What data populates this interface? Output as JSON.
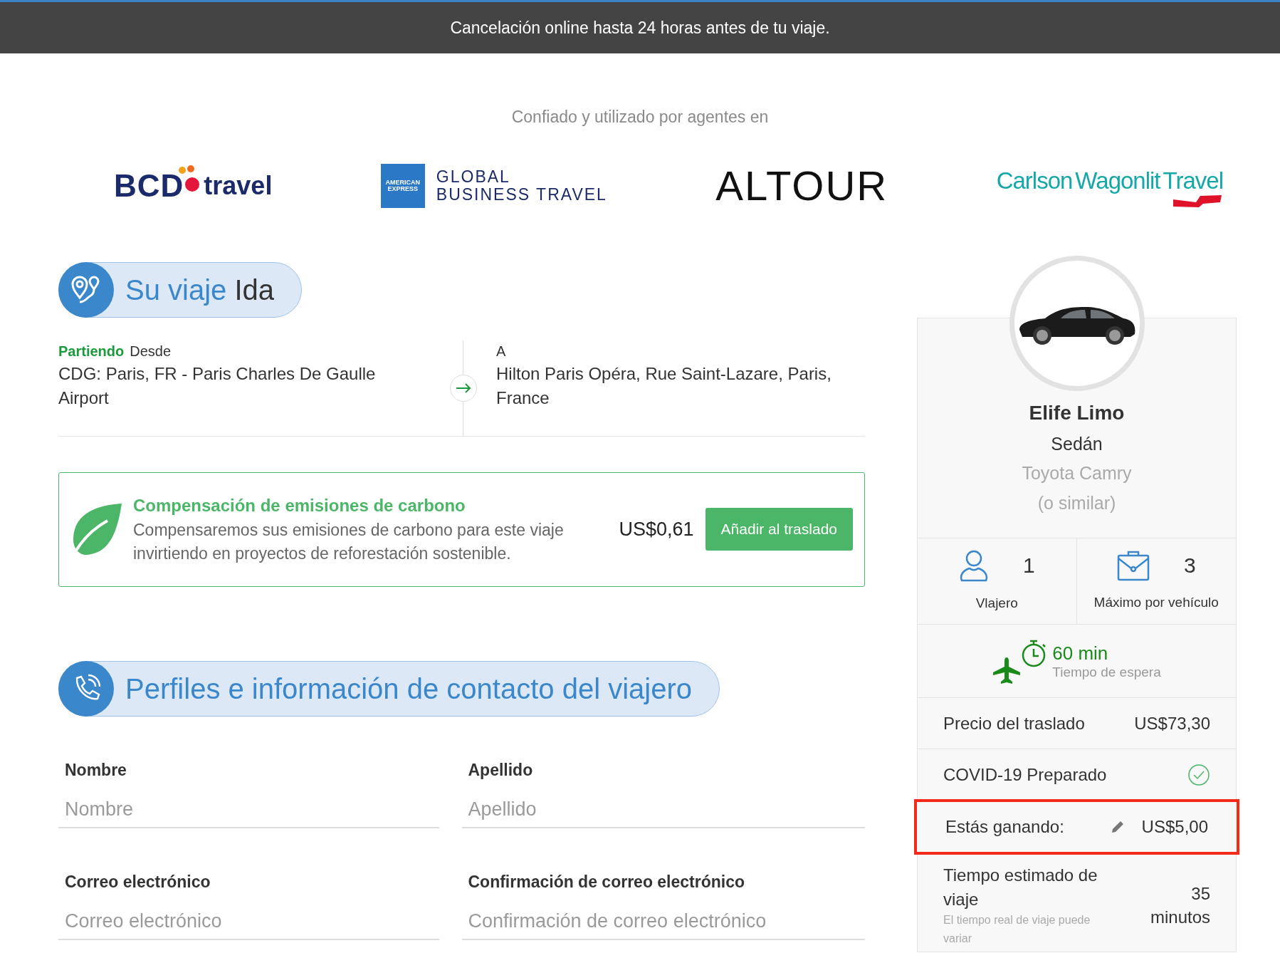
{
  "banner": {
    "text": "Cancelación online hasta 24 horas antes de tu viaje."
  },
  "trusted": {
    "caption": "Confiado y utilizado por agentes en",
    "logos": [
      {
        "kind": "bcd",
        "parts": [
          "BCD",
          "travel"
        ]
      },
      {
        "kind": "amex",
        "badge": "AMERICAN EXPRESS",
        "parts": [
          "GLOBAL",
          "BUSINESS TRAVEL"
        ]
      },
      {
        "kind": "wordmark",
        "parts": [
          "ALTOUR"
        ]
      },
      {
        "kind": "cwt",
        "parts": [
          "Carlson",
          "Wagonlit",
          "Travel"
        ]
      }
    ]
  },
  "trip": {
    "title_accent": "Su viaje",
    "title_rest": "Ida",
    "from": {
      "status": "Partiendo",
      "label": "Desde",
      "address": "CDG: Paris, FR - Paris Charles De Gaulle Airport"
    },
    "to": {
      "label": "A",
      "address": "Hilton Paris Opéra, Rue Saint-Lazare, Paris, France"
    }
  },
  "carbon": {
    "title": "Compensación de emisiones de carbono",
    "text": "Compensaremos sus emisiones de carbono para este viaje invirtiendo en proyectos de reforestación sostenible.",
    "price": "US$0,61",
    "button": "Añadir al traslado"
  },
  "contact": {
    "title": "Perfiles e información de contacto del viajero",
    "fields": [
      {
        "label": "Nombre",
        "placeholder": "Nombre"
      },
      {
        "label": "Apellido",
        "placeholder": "Apellido"
      },
      {
        "label": "Correo electrónico",
        "placeholder": "Correo electrónico"
      },
      {
        "label": "Confirmación de correo electrónico",
        "placeholder": "Confirmación de correo electrónico"
      }
    ]
  },
  "vehicle": {
    "company": "Elife Limo",
    "type": "Sedán",
    "model": "Toyota Camry",
    "note": "(o similar)",
    "stats": [
      {
        "kind": "traveler",
        "count": "1",
        "label": "Vlajero"
      },
      {
        "kind": "luggage",
        "count": "3",
        "label": "Máximo por vehículo"
      }
    ],
    "wait": {
      "value": "60 min",
      "label": "Tiempo de espera"
    },
    "rows": [
      {
        "kind": "price",
        "label": "Precio del traslado",
        "value": "US$73,30",
        "highlighted": false
      },
      {
        "kind": "check",
        "label": "COVID-19 Preparado",
        "checked": true,
        "highlighted": false
      },
      {
        "kind": "edit",
        "label": "Estás ganando:",
        "value": "US$5,00",
        "highlighted": true
      },
      {
        "kind": "time",
        "label": "Tiempo estimado de viaje",
        "note": "El tiempo real de viaje puede variar",
        "value": "35 minutos",
        "highlighted": false
      }
    ]
  }
}
